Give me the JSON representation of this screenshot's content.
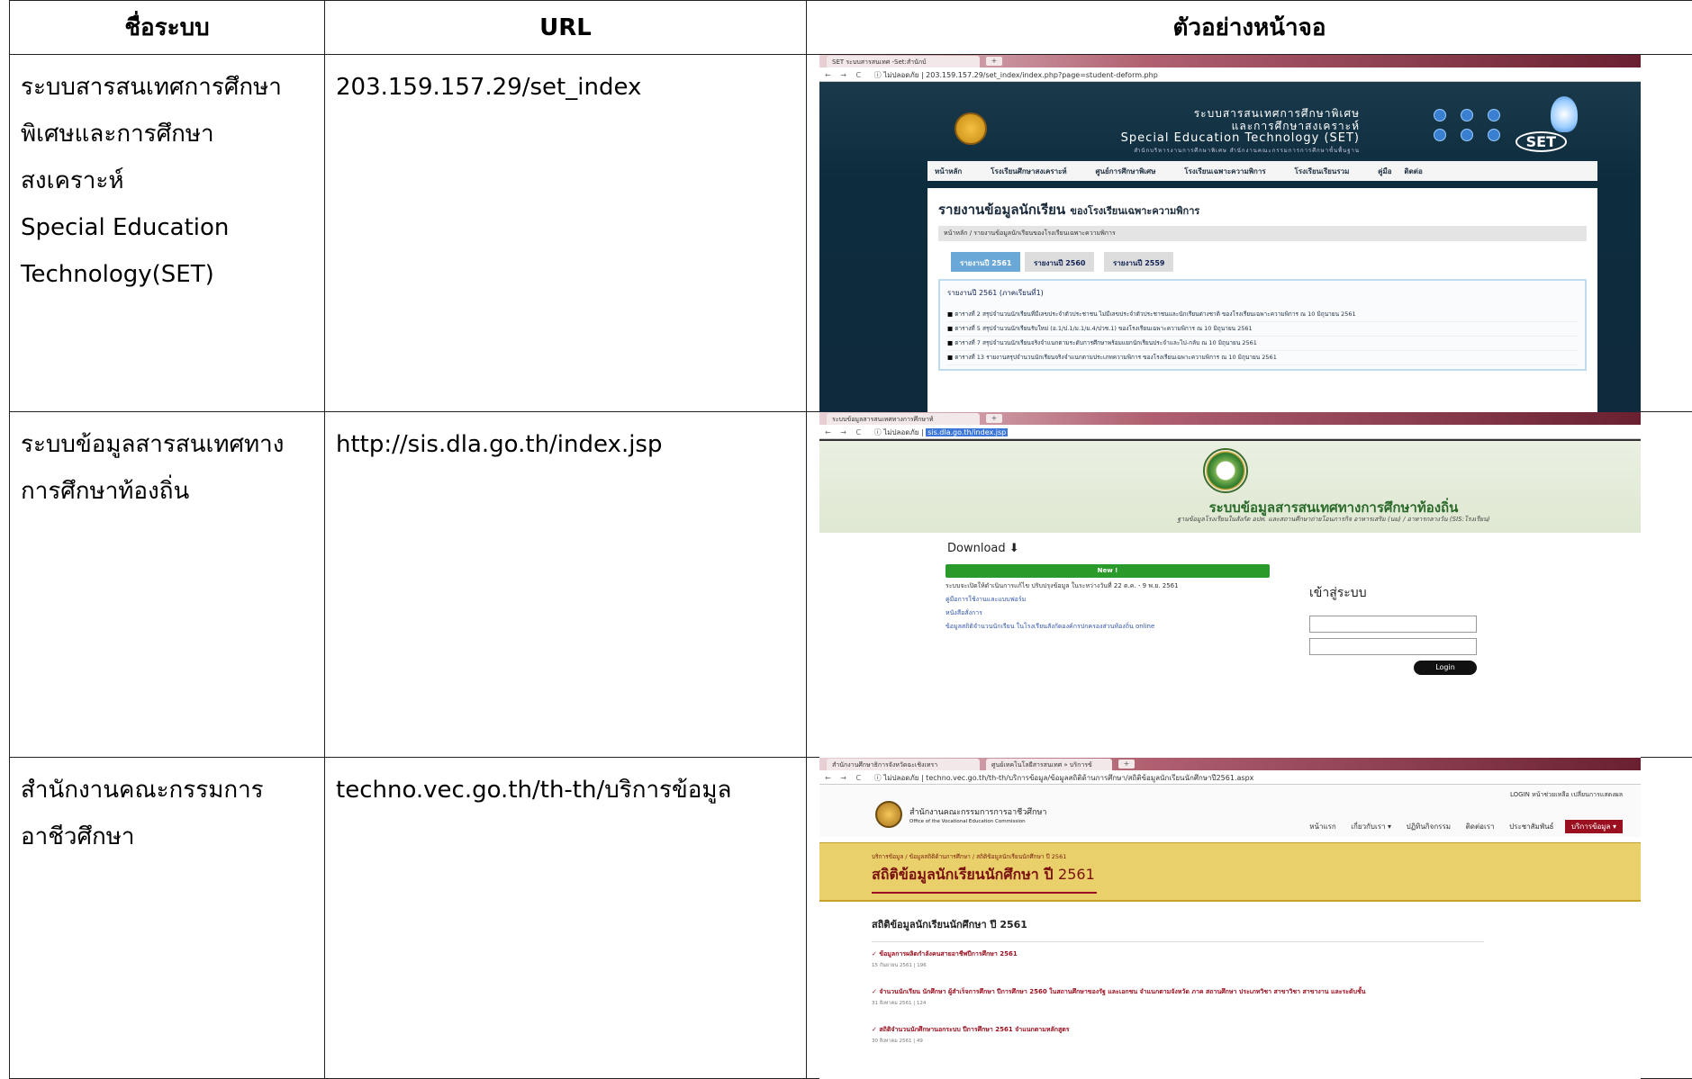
{
  "headers": {
    "name": "ชื่อระบบ",
    "url": "URL",
    "screen": "ตัวอย่างหน้าจอ"
  },
  "rows": [
    {
      "name_lines": [
        "ระบบสารสนเทศการศึกษา",
        "พิเศษและการศึกษา",
        "สงเคราะห์",
        "Special Education",
        "Technology(SET)"
      ],
      "url": "203.159.157.29/set_index"
    },
    {
      "name_lines": [
        "ระบบข้อมูลสารสนเทศทาง",
        "การศึกษาท้องถิ่น"
      ],
      "url": "http://sis.dla.go.th/index.jsp"
    },
    {
      "name_lines": [
        "สำนักงานคณะกรรมการ",
        "อาชีวศึกษา"
      ],
      "url": "techno.vec.go.th/th-th/บริการข้อมูล"
    }
  ],
  "shot1": {
    "tab": "SET ระบบสารสนเทศ -Set:สำนักบ์",
    "newtab": "+",
    "nav_buttons": "← → C",
    "addr": "ⓘ ไม่ปลอดภัย | 203.159.157.29/set_index/index.php?page=student-deform.php",
    "title_th1": "ระบบสารสนเทศการศึกษาพิเศษ",
    "title_th2": "และการศึกษาสงเคราะห์",
    "title_en": "Special Education Technology (SET)",
    "title_sub": "สำนักบริหารงานการศึกษาพิเศษ สำนักงานคณะกรรมการการศึกษาขั้นพื้นฐาน",
    "mark": "SET",
    "menu": [
      "หน้าหลัก",
      "โรงเรียนศึกษาสงเคราะห์",
      "ศูนย์การศึกษาพิเศษ",
      "โรงเรียนเฉพาะความพิการ",
      "โรงเรียนเรียนรวม",
      "คู่มือ",
      "ติดต่อ"
    ],
    "heading": "รายงานข้อมูลนักเรียน",
    "heading_small": "ของโรงเรียนเฉพาะความพิการ",
    "breadcrumb": "หน้าหลัก / รายงานข้อมูลนักเรียนของโรงเรียนเฉพาะความพิการ",
    "tabs": [
      "รายงานปี 2561",
      "รายงานปี 2560",
      "รายงานปี 2559"
    ],
    "box_title": "รายงานปี 2561 (ภาคเรียนที่1)",
    "items": [
      "ตารางที่ 2 สรุปจำนวนนักเรียนที่มีเลขประจำตัวประชาชน ไม่มีเลขประจำตัวประชาชนและนักเรียนต่างชาติ ของโรงเรียนเฉพาะความพิการ ณ 10 มิถุนายน 2561",
      "ตารางที่ 5 สรุปจำนวนนักเรียนรับใหม่ (อ.1/ป.1/ม.1/ม.4/ปวช.1) ของโรงเรียนเฉพาะความพิการ ณ 10 มิถุนายน 2561",
      "ตารางที่ 7 สรุปจำนวนนักเรียนจริงจำแนกตามระดับการศึกษาพร้อมแยกนักเรียนประจำและไป-กลับ ณ 10 มิถุนายน 2561",
      "ตารางที่ 13 รายงานสรุปจำนวนนักเรียนจริงจำแนกตามประเภทความพิการ ของโรงเรียนเฉพาะความพิการ ณ 10 มิถุนายน 2561"
    ]
  },
  "shot2": {
    "tab": "ระบบข้อมูลสารสนเทศทางการศึกษาท้",
    "newtab": "+",
    "nav_buttons": "← → C",
    "addr_prefix": "ⓘ ไม่ปลอดภัย |",
    "addr_url": "sis.dla.go.th/index.jsp",
    "title": "ระบบข้อมูลสารสนเทศทางการศึกษาท้องถิ่น",
    "subtitle": "ฐานข้อมูลโรงเรียนในสังกัด อปท. และสถานศึกษาถ่ายโอนภารกิจ อาหารเสริม (นม) / อาหารกลางวัน (SIS:โรงเรียน)",
    "download": "Download ⬇",
    "new_label": "New !",
    "notice": "ระบบจะเปิดให้ดำเนินการแก้ไข ปรับปรุงข้อมูล ในระหว่างวันที่ 22 ต.ค. - 9 พ.ย. 2561",
    "links": [
      "คู่มือการใช้งานและแบบฟอร์ม",
      "หนังสือสั่งการ",
      "ข้อมูลสถิติจำนวนนักเรียน ในโรงเรียนสังกัดองค์กรปกครองส่วนท้องถิ่น online"
    ],
    "login_title": "เข้าสู่ระบบ",
    "login_button": "Login"
  },
  "shot3": {
    "tab1": "สำนักงานศึกษาธิการจังหวัดฉะเชิงเทรา",
    "tab2": "ศูนย์เทคโนโลยีสารสนเทศ » บริการข้",
    "newtab": "+",
    "nav_buttons": "← → C",
    "addr": "ⓘ ไม่ปลอดภัย | techno.vec.go.th/th-th/บริการข้อมูล/ข้อมูลสถิติด้านการศึกษา/สถิติข้อมูลนักเรียนนักศึกษาปี2561.aspx",
    "org_th": "สำนักงานคณะกรรมการการอาชีวศึกษา",
    "org_en": "Office of the Vocational Education Commission",
    "top_right": "LOGIN   หน้าช่วยเหลือ   เปลี่ยนการแสดงผล",
    "menu": [
      "หน้าแรก",
      "เกี่ยวกับเรา ▾",
      "ปฏิทินกิจกรรม",
      "ติดต่อเรา",
      "ประชาสัมพันธ์"
    ],
    "menu_active": "บริการข้อมูล ▾",
    "breadcrumb": "บริการข้อมูล / ข้อมูลสถิติด้านการศึกษา / สถิติข้อมูลนักเรียนนักศึกษา ปี 2561",
    "banner_title": "สถิติข้อมูลนักเรียนนักศึกษา ปี",
    "banner_year": "2561",
    "section_title": "สถิติข้อมูลนักเรียนนักศึกษา ปี 2561",
    "items": [
      {
        "title": "ข้อมูลการผลิตกำลังคนสายอาชีพปีการศึกษา 2561",
        "meta": "15 กันยายน 2561 | 196"
      },
      {
        "title": "จำนวนนักเรียน นักศึกษา ผู้สำเร็จการศึกษา ปีการศึกษา 2560 ในสถานศึกษาของรัฐ และเอกชน จำแนกตามจังหวัด ภาค สถานศึกษา ประเภทวิชา สาขาวิชา สาขางาน และระดับชั้น",
        "meta": "31 สิงหาคม 2561 | 124"
      },
      {
        "title": "สถิติจำนวนนักศึกษานอกระบบ ปีการศึกษา 2561 จำแนกตามหลักสูตร",
        "meta": "30 สิงหาคม 2561 | 49"
      }
    ]
  }
}
